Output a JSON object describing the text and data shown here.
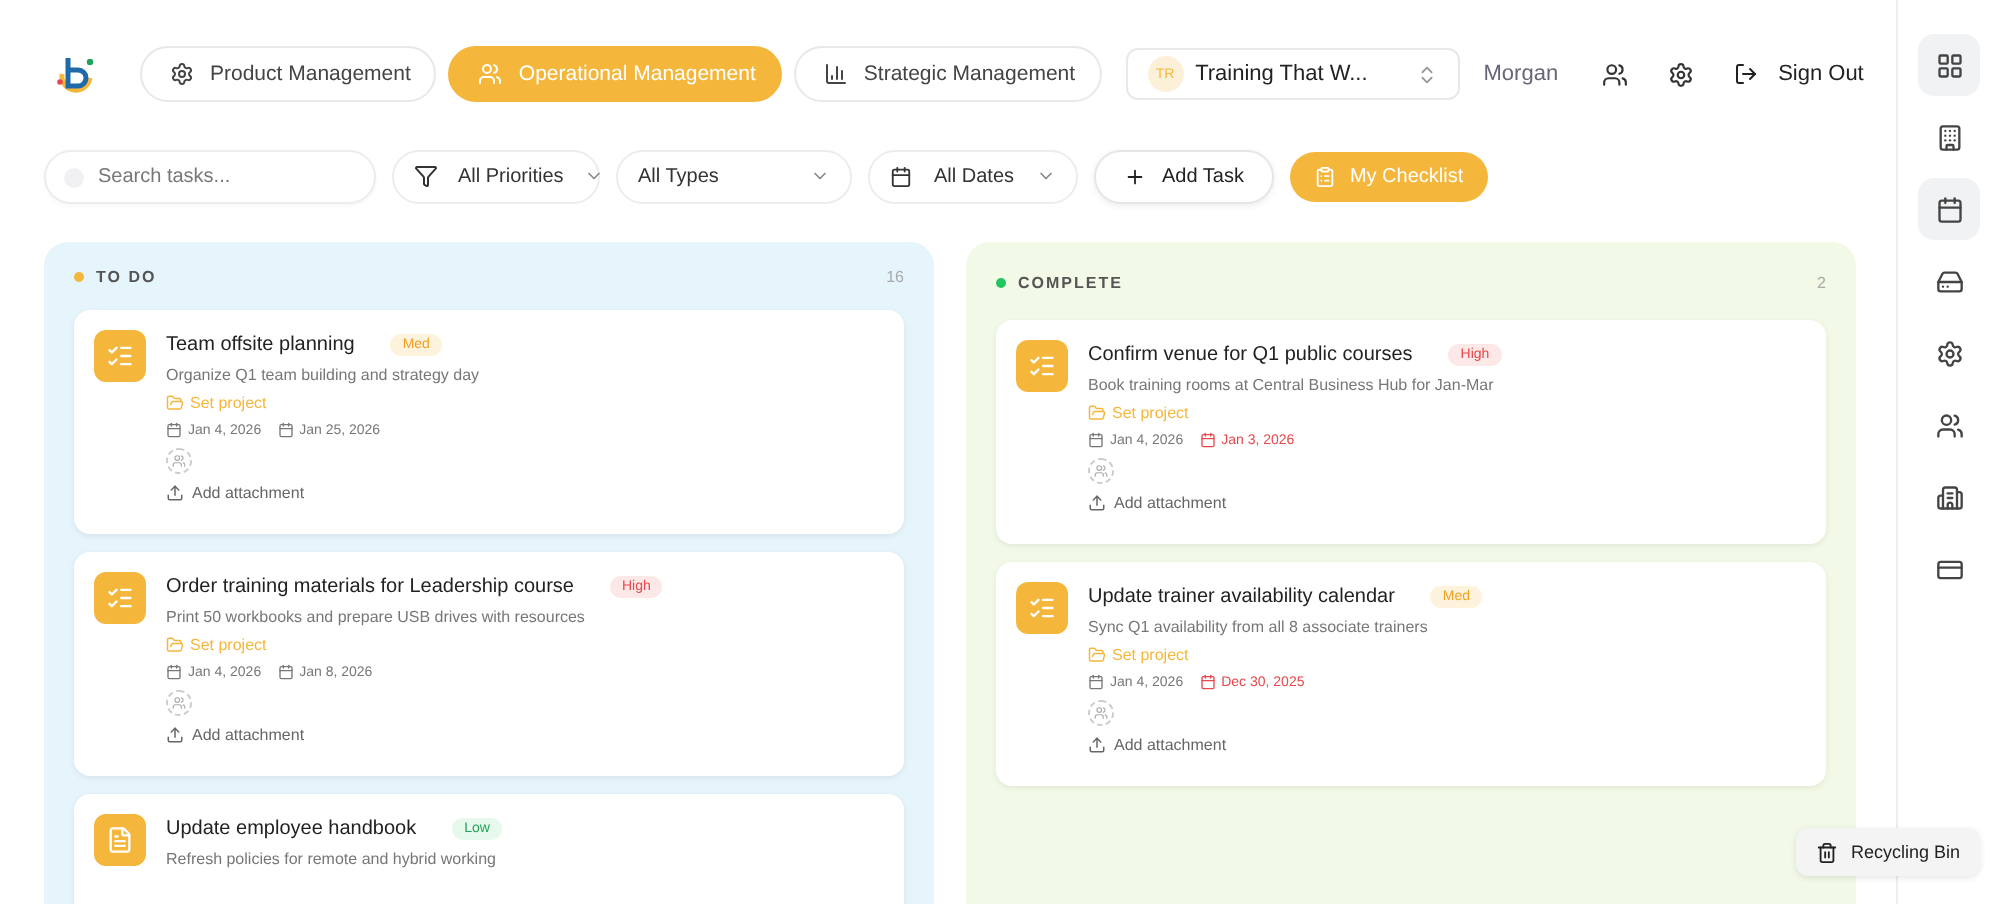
{
  "nav": {
    "tabs": [
      {
        "label": "Product Management",
        "kind": "gear",
        "selected": false
      },
      {
        "label": "Operational Management",
        "kind": "users",
        "selected": true
      },
      {
        "label": "Strategic Management",
        "kind": "chart",
        "selected": false
      }
    ],
    "org": {
      "initials": "TR",
      "name": "Training That W..."
    },
    "user": "Morgan",
    "sign_out": "Sign Out"
  },
  "filters": {
    "search": {
      "placeholder": "Search tasks..."
    },
    "priority": "All Priorities",
    "type": "All Types",
    "dates": "All Dates",
    "add_task": "Add Task",
    "checklist": "My Checklist"
  },
  "columns": [
    {
      "title": "TO DO",
      "count": "16",
      "color": "#f5b73b",
      "kind": "todo",
      "tasks": [
        {
          "kind": "checklist",
          "title": "Team offsite planning",
          "priority": {
            "label": "Med",
            "kind": "med"
          },
          "description": "Organize Q1 team building and strategy day",
          "project": "Set project",
          "start": "Jan 4, 2026",
          "due": "Jan 25, 2026",
          "overdue": false,
          "attachment": "Add attachment"
        },
        {
          "kind": "checklist",
          "title": "Order training materials for Leadership course",
          "priority": {
            "label": "High",
            "kind": "high"
          },
          "description": "Print 50 workbooks and prepare USB drives with resources",
          "project": "Set project",
          "start": "Jan 4, 2026",
          "due": "Jan 8, 2026",
          "overdue": false,
          "attachment": "Add attachment"
        },
        {
          "kind": "document",
          "title": "Update employee handbook",
          "priority": {
            "label": "Low",
            "kind": "low"
          },
          "description": "Refresh policies for remote and hybrid working"
        }
      ]
    },
    {
      "title": "COMPLETE",
      "count": "2",
      "color": "#22c55e",
      "kind": "complete",
      "tasks": [
        {
          "kind": "checklist",
          "title": "Confirm venue for Q1 public courses",
          "priority": {
            "label": "High",
            "kind": "high"
          },
          "description": "Book training rooms at Central Business Hub for Jan-Mar",
          "project": "Set project",
          "start": "Jan 4, 2026",
          "due": "Jan 3, 2026",
          "overdue": true,
          "attachment": "Add attachment"
        },
        {
          "kind": "checklist",
          "title": "Update trainer availability calendar",
          "priority": {
            "label": "Med",
            "kind": "med"
          },
          "description": "Sync Q1 availability from all 8 associate trainers",
          "project": "Set project",
          "start": "Jan 4, 2026",
          "due": "Dec 30, 2025",
          "overdue": true,
          "attachment": "Add attachment"
        }
      ]
    }
  ],
  "recycling_bin": "Recycling Bin",
  "sidebar": [
    {
      "kind": "grid",
      "selected": true
    },
    {
      "kind": "building",
      "selected": false
    },
    {
      "kind": "calendar",
      "selected": true
    },
    {
      "kind": "drive",
      "selected": false
    },
    {
      "kind": "settings",
      "selected": false
    },
    {
      "kind": "users",
      "selected": false
    },
    {
      "kind": "office",
      "selected": false
    },
    {
      "kind": "card",
      "selected": false
    }
  ]
}
